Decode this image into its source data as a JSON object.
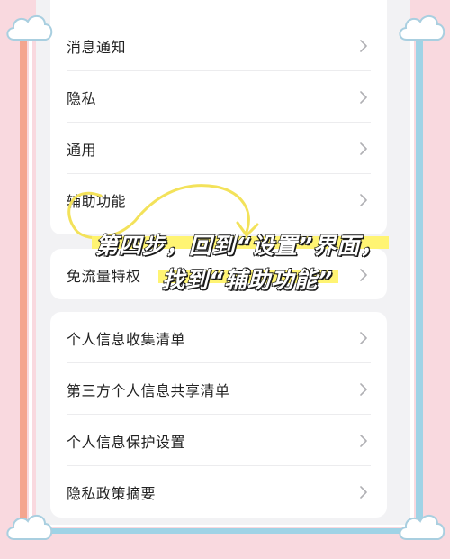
{
  "settings": {
    "group1": [
      {
        "label": "消息通知"
      },
      {
        "label": "隐私"
      },
      {
        "label": "通用"
      },
      {
        "label": "辅助功能"
      }
    ],
    "group2": [
      {
        "label": "免流量特权"
      }
    ],
    "group3": [
      {
        "label": "个人信息收集清单"
      },
      {
        "label": "第三方个人信息共享清单"
      },
      {
        "label": "个人信息保护设置"
      },
      {
        "label": "隐私政策摘要"
      }
    ]
  },
  "annotation": {
    "line1": "第四步，回到“设置”界面，",
    "line2": "找到“辅助功能”",
    "highlight_color": "#fff36b",
    "scribble_color": "#f3e25a"
  },
  "icons": {
    "row_arrow": "chevron-right-icon",
    "decoration": "cloud-icon"
  },
  "colors": {
    "frame_pink": "#f9d9df",
    "stripe_orange": "#f4a58f",
    "stripe_blue": "#9fd3e6",
    "screen_bg": "#f2f2f4",
    "card_bg": "#ffffff"
  }
}
